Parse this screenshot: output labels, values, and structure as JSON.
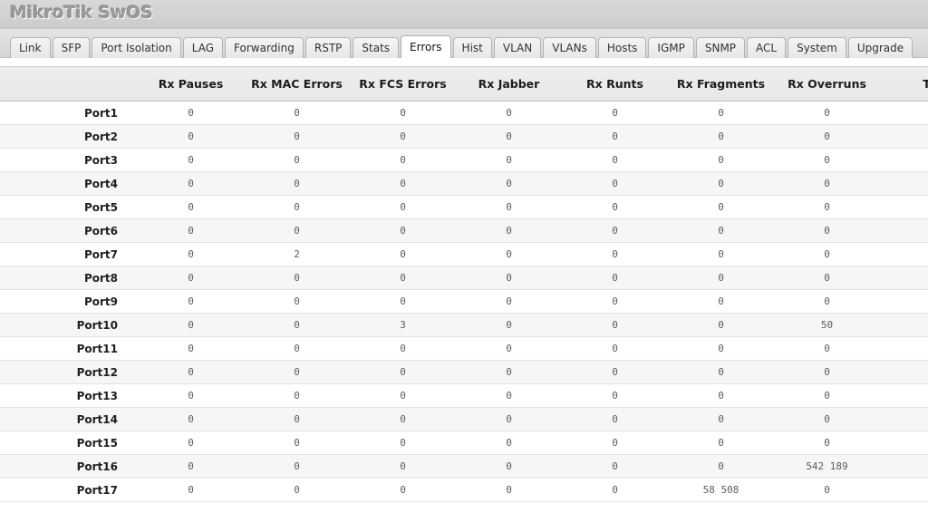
{
  "app": {
    "title": "MikroTik SwOS"
  },
  "tabs": [
    {
      "label": "Link",
      "active": false
    },
    {
      "label": "SFP",
      "active": false
    },
    {
      "label": "Port Isolation",
      "active": false
    },
    {
      "label": "LAG",
      "active": false
    },
    {
      "label": "Forwarding",
      "active": false
    },
    {
      "label": "RSTP",
      "active": false
    },
    {
      "label": "Stats",
      "active": false
    },
    {
      "label": "Errors",
      "active": true
    },
    {
      "label": "Hist",
      "active": false
    },
    {
      "label": "VLAN",
      "active": false
    },
    {
      "label": "VLANs",
      "active": false
    },
    {
      "label": "Hosts",
      "active": false
    },
    {
      "label": "IGMP",
      "active": false
    },
    {
      "label": "SNMP",
      "active": false
    },
    {
      "label": "ACL",
      "active": false
    },
    {
      "label": "System",
      "active": false
    },
    {
      "label": "Upgrade",
      "active": false
    }
  ],
  "table": {
    "columns": [
      "",
      "Rx Pauses",
      "Rx MAC Errors",
      "Rx FCS Errors",
      "Rx Jabber",
      "Rx Runts",
      "Rx Fragments",
      "Rx Overruns",
      "Tx"
    ],
    "rows": [
      {
        "port": "Port1",
        "values": [
          "0",
          "0",
          "0",
          "0",
          "0",
          "0",
          "0",
          ""
        ]
      },
      {
        "port": "Port2",
        "values": [
          "0",
          "0",
          "0",
          "0",
          "0",
          "0",
          "0",
          ""
        ]
      },
      {
        "port": "Port3",
        "values": [
          "0",
          "0",
          "0",
          "0",
          "0",
          "0",
          "0",
          ""
        ]
      },
      {
        "port": "Port4",
        "values": [
          "0",
          "0",
          "0",
          "0",
          "0",
          "0",
          "0",
          ""
        ]
      },
      {
        "port": "Port5",
        "values": [
          "0",
          "0",
          "0",
          "0",
          "0",
          "0",
          "0",
          ""
        ]
      },
      {
        "port": "Port6",
        "values": [
          "0",
          "0",
          "0",
          "0",
          "0",
          "0",
          "0",
          ""
        ]
      },
      {
        "port": "Port7",
        "values": [
          "0",
          "2",
          "0",
          "0",
          "0",
          "0",
          "0",
          ""
        ]
      },
      {
        "port": "Port8",
        "values": [
          "0",
          "0",
          "0",
          "0",
          "0",
          "0",
          "0",
          ""
        ]
      },
      {
        "port": "Port9",
        "values": [
          "0",
          "0",
          "0",
          "0",
          "0",
          "0",
          "0",
          ""
        ]
      },
      {
        "port": "Port10",
        "values": [
          "0",
          "0",
          "3",
          "0",
          "0",
          "0",
          "50",
          ""
        ]
      },
      {
        "port": "Port11",
        "values": [
          "0",
          "0",
          "0",
          "0",
          "0",
          "0",
          "0",
          ""
        ]
      },
      {
        "port": "Port12",
        "values": [
          "0",
          "0",
          "0",
          "0",
          "0",
          "0",
          "0",
          ""
        ]
      },
      {
        "port": "Port13",
        "values": [
          "0",
          "0",
          "0",
          "0",
          "0",
          "0",
          "0",
          ""
        ]
      },
      {
        "port": "Port14",
        "values": [
          "0",
          "0",
          "0",
          "0",
          "0",
          "0",
          "0",
          ""
        ]
      },
      {
        "port": "Port15",
        "values": [
          "0",
          "0",
          "0",
          "0",
          "0",
          "0",
          "0",
          ""
        ]
      },
      {
        "port": "Port16",
        "values": [
          "0",
          "0",
          "0",
          "0",
          "0",
          "0",
          "542 189",
          ""
        ]
      },
      {
        "port": "Port17",
        "values": [
          "0",
          "0",
          "0",
          "0",
          "0",
          "58 508",
          "0",
          ""
        ]
      }
    ]
  },
  "colors": {
    "titlebar": "#d4d4d4",
    "title_text": "#9a9a9a",
    "tab_active_bg": "#ffffff",
    "tab_bg": "#ebebeb",
    "header_bg": "#eaeaea",
    "row_alt_bg": "#f6f6f6",
    "value_text": "#5d5d5d"
  }
}
